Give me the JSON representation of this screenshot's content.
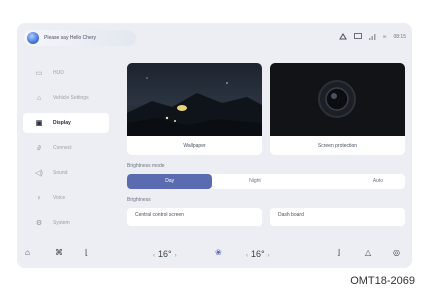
{
  "voice": {
    "placeholder": "Please say Hello Chery"
  },
  "status": {
    "t1": "∞",
    "t2": "08:15"
  },
  "sidebar": {
    "items": [
      {
        "label": "HUD",
        "icon": "hud-icon"
      },
      {
        "label": "Vehicle Settings",
        "icon": "car-icon"
      },
      {
        "label": "Display",
        "icon": "display-icon",
        "active": true
      },
      {
        "label": "Connect",
        "icon": "link-icon"
      },
      {
        "label": "Sound",
        "icon": "speaker-icon"
      },
      {
        "label": "Voice",
        "icon": "microphone-icon"
      },
      {
        "label": "System",
        "icon": "gear-icon"
      }
    ]
  },
  "cards": {
    "wallpaper": "Wallpaper",
    "screensaver": "Screen protection"
  },
  "brightness_mode": {
    "title": "Brightness mode",
    "options": [
      "Day",
      "Night",
      "Auto"
    ],
    "selected": "Day"
  },
  "brightness": {
    "title": "Brightness",
    "central": "Central control screen",
    "dash": "Dash board"
  },
  "dock": {
    "left_temp": "16°",
    "right_temp": "16°"
  },
  "figure_code": "OMT18-2069"
}
